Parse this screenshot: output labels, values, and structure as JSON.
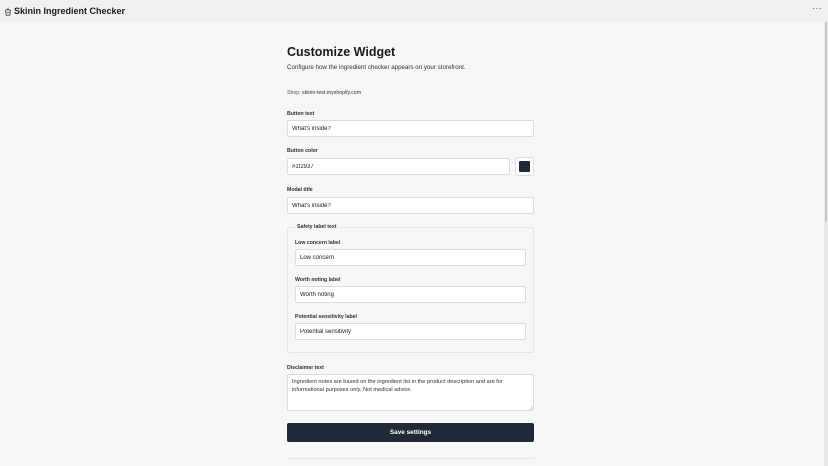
{
  "app": {
    "title": "Skinin Ingredient Checker",
    "menu_label": "···"
  },
  "page": {
    "title": "Customize Widget",
    "subtitle": "Configure how the ingredient checker appears on your storefront.",
    "shop_prefix": "Shop:",
    "shop_domain": "skinin-test.myshopify.com"
  },
  "form": {
    "button_text": {
      "label": "Button text",
      "value": "What's inside?"
    },
    "button_color": {
      "label": "Button color",
      "value": "#1f2937",
      "swatch": "#1f2937"
    },
    "modal_title": {
      "label": "Modal title",
      "value": "What's inside?"
    },
    "safety": {
      "legend": "Safety label text",
      "low": {
        "label": "Low concern label",
        "value": "Low concern"
      },
      "worth": {
        "label": "Worth noting label",
        "value": "Worth noting"
      },
      "potential": {
        "label": "Potential sensitivity label",
        "value": "Potential sensitivity"
      }
    },
    "disclaimer": {
      "label": "Disclaimer text",
      "value": "Ingredient notes are based on the ingredient list in the product description and are for informational purposes only. Not medical advice."
    },
    "save_label": "Save settings"
  },
  "colors": {
    "primary": "#1f2937",
    "background": "#f7f7f7",
    "topbar": "#f1f1f1"
  }
}
